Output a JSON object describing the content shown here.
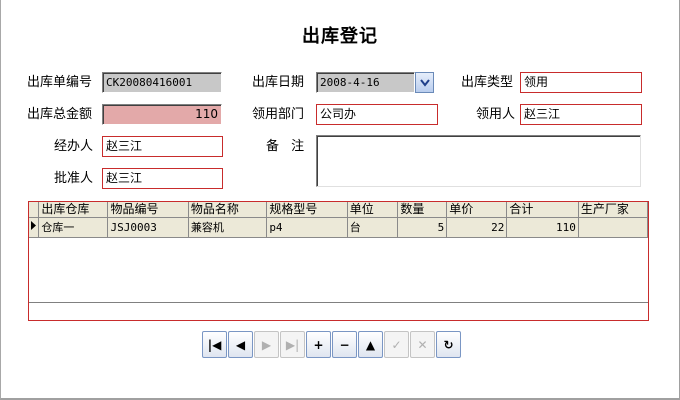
{
  "form": {
    "title": "出库登记",
    "labels": {
      "order_no": "出库单编号",
      "date": "出库日期",
      "type": "出库类型",
      "total": "出库总金额",
      "dept": "领用部门",
      "receiver": "领用人",
      "handler": "经办人",
      "remark": "备 注",
      "approver": "批准人"
    },
    "values": {
      "order_no": "CK20080416001",
      "date": "2008-4-16",
      "type": "领用",
      "total": "110",
      "dept": "公司办",
      "receiver": "赵三江",
      "handler": "赵三江",
      "remark": "",
      "approver": "赵三江"
    }
  },
  "grid": {
    "columns": [
      "出库仓库",
      "物品编号",
      "物品名称",
      "规格型号",
      "单位",
      "数量",
      "单价",
      "合计",
      "生产厂家"
    ],
    "rows": [
      [
        "仓库一",
        "JSJ0003",
        "兼容机",
        "p4",
        "台",
        "5",
        "22",
        "110",
        ""
      ]
    ]
  },
  "navigator": {
    "buttons": [
      {
        "name": "first-record",
        "glyph": "|◀",
        "enabled": true
      },
      {
        "name": "prior-record",
        "glyph": "◀",
        "enabled": true
      },
      {
        "name": "next-record",
        "glyph": "▶",
        "enabled": false
      },
      {
        "name": "last-record",
        "glyph": "▶|",
        "enabled": false
      },
      {
        "name": "insert-record",
        "glyph": "+",
        "enabled": true
      },
      {
        "name": "delete-record",
        "glyph": "−",
        "enabled": true
      },
      {
        "name": "edit-record",
        "glyph": "▲",
        "enabled": true
      },
      {
        "name": "post-edit",
        "glyph": "✓",
        "enabled": false
      },
      {
        "name": "cancel-edit",
        "glyph": "✕",
        "enabled": false
      },
      {
        "name": "refresh-data",
        "glyph": "↻",
        "enabled": true
      }
    ]
  }
}
